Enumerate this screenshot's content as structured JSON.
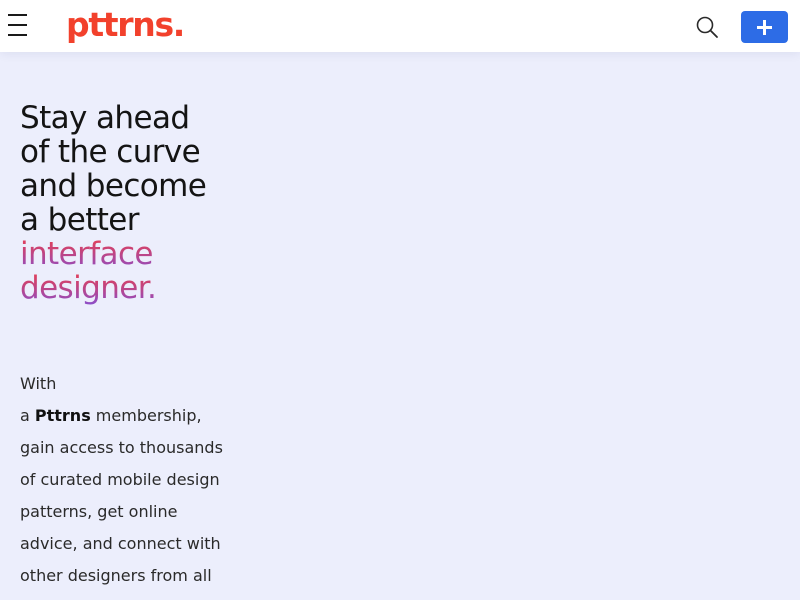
{
  "header": {
    "menu_icon": "hamburger-menu-icon",
    "logo": "pttrns.",
    "search_icon": "search-icon",
    "add_icon": "plus-icon",
    "add_button_color": "#2d6ce6",
    "logo_color": "#f2412c"
  },
  "hero": {
    "headline_lines": [
      "Stay ahead",
      "of the curve",
      "and become",
      "a better"
    ],
    "highlight_lines": [
      "interface",
      "designer."
    ],
    "highlight_gradient": [
      "#e63f55",
      "#8a4ecb"
    ],
    "intro": {
      "line1": "With",
      "line2_prefix": "a ",
      "brand": "Pttrns",
      "line2_suffix": " membership,",
      "line3": "gain access to thousands",
      "line4": "of curated mobile design",
      "line5": "patterns, get online",
      "line6": "advice, and connect with",
      "line7": "other designers from all"
    }
  },
  "colors": {
    "page_background": "#eceefc",
    "header_background": "#ffffff"
  }
}
